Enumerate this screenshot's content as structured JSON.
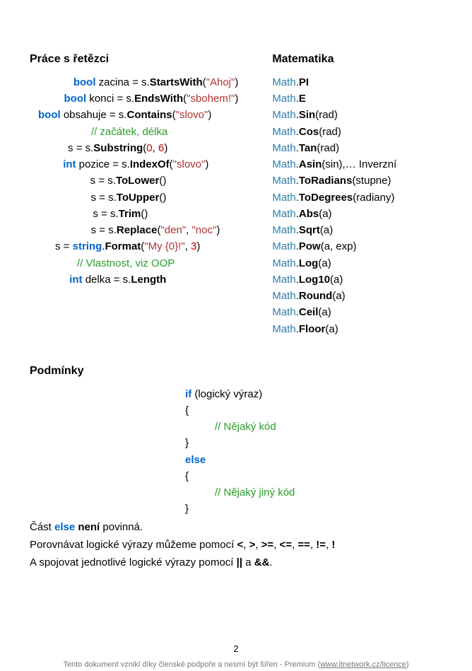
{
  "headings": {
    "strings": "Práce s řetězci",
    "math": "Matematika",
    "cond": "Podmínky"
  },
  "strings_lines": {
    "l1": {
      "kw": "bool",
      "name": " zacina = s.",
      "mtd": "StartsWith",
      "open": "(",
      "arg": "\"Ahoj\"",
      "close": ")"
    },
    "l2": {
      "kw": "bool",
      "name": " konci = s.",
      "mtd": "EndsWith",
      "open": "(",
      "arg": "\"sbohem!\"",
      "close": ")"
    },
    "l3": {
      "kw": "bool",
      "name": " obsahuje = s.",
      "mtd": "Contains",
      "open": "(",
      "arg": "\"slovo\"",
      "close": ")"
    },
    "l4": {
      "cmt": "// začátek, délka"
    },
    "l5": {
      "pre": "s = s.",
      "mtd": "Substring",
      "open": "(",
      "n1": "0",
      "sep": ", ",
      "n2": "6",
      "close": ")"
    },
    "l6": {
      "kw": "int",
      "name": " pozice = s.",
      "mtd": "IndexOf",
      "open": "(",
      "arg": "\"slovo\"",
      "close": ")"
    },
    "l7": {
      "pre": "s = s.",
      "mtd": "ToLower",
      "open": "()",
      "close": ""
    },
    "l8": {
      "pre": "s = s.",
      "mtd": "ToUpper",
      "open": "()",
      "close": ""
    },
    "l9": {
      "pre": "s = s.",
      "mtd": "Trim",
      "open": "()",
      "close": ""
    },
    "l10": {
      "pre": "s =  s.",
      "mtd": "Replace",
      "open": "(",
      "a1": "\"den\"",
      "sep": ", ",
      "a2": "\"noc\"",
      "close": ")"
    },
    "l11": {
      "pre": "s = ",
      "cls": "string",
      "dot": ".",
      "mtd": "Format",
      "open": "(",
      "a1": "\"My {0}!\"",
      "sep": ", ",
      "n1": "3",
      "close": ")"
    },
    "l12": {
      "cmt": "// Vlastnost, viz OOP"
    },
    "l13": {
      "kw": "int",
      "name": " delka = s.",
      "mtd": "Length"
    }
  },
  "math_lines": {
    "m1": {
      "cls": "Math",
      "dot": ".",
      "mtd": "PI",
      "rest": ""
    },
    "m2": {
      "cls": "Math",
      "dot": ".",
      "mtd": "E",
      "rest": ""
    },
    "m3": {
      "cls": "Math",
      "dot": ".",
      "mtd": "Sin",
      "rest": "(rad)"
    },
    "m4": {
      "cls": "Math",
      "dot": ".",
      "mtd": "Cos",
      "rest": "(rad)"
    },
    "m5": {
      "cls": "Math",
      "dot": ".",
      "mtd": "Tan",
      "rest": "(rad)"
    },
    "m6": {
      "cls": "Math",
      "dot": ".",
      "mtd": "Asin",
      "rest": "(sin),… Inverzní"
    },
    "m7": {
      "cls": "Math",
      "dot": ".",
      "mtd": "ToRadians",
      "rest": "(stupne)"
    },
    "m8": {
      "cls": "Math",
      "dot": ".",
      "mtd": "ToDegrees",
      "rest": "(radiany)"
    },
    "m9": {
      "cls": "Math",
      "dot": ".",
      "mtd": "Abs",
      "rest": "(a)"
    },
    "m10": {
      "cls": "Math",
      "dot": ".",
      "mtd": "Sqrt",
      "rest": "(a)"
    },
    "m11": {
      "cls": "Math",
      "dot": ".",
      "mtd": "Pow",
      "rest": "(a, exp)"
    },
    "m12": {
      "cls": "Math",
      "dot": ".",
      "mtd": "Log",
      "rest": "(a)"
    },
    "m13": {
      "cls": "Math",
      "dot": ".",
      "mtd": "Log10",
      "rest": "(a)"
    },
    "m14": {
      "cls": "Math",
      "dot": ".",
      "mtd": "Round",
      "rest": "(a)"
    },
    "m15": {
      "cls": "Math",
      "dot": ".",
      "mtd": "Ceil",
      "rest": "(a)"
    },
    "m16": {
      "cls": "Math",
      "dot": ".",
      "mtd": "Floor",
      "rest": "(a)"
    }
  },
  "cond": {
    "l1": {
      "kw": "if",
      "rest": " (logický výraz)"
    },
    "l2": "{",
    "l3": "// Nějaký kód",
    "l4": "}",
    "l5": {
      "kw": "else"
    },
    "l6": "{",
    "l7": "// Nějaký jiný kód",
    "l8": "}"
  },
  "paras": {
    "p1_pre": "Část ",
    "p1_else": "else",
    "p1_mid": " ",
    "p1_neni": "není",
    "p1_post": " povinná.",
    "p2_pre": "Porovnávat logické výrazy můžeme pomocí ",
    "op_lt": "<",
    "sep": ", ",
    "op_gt": ">",
    "op_ge": ">=",
    "op_le": "<=",
    "op_eq": "==",
    "op_ne": "!=",
    "op_not": "!",
    "p3_pre": "A spojovat jednotlivé logické výrazy pomocí ",
    "op_or": "||",
    "p3_mid": " a ",
    "op_and": "&&",
    "p3_post": "."
  },
  "footer": {
    "page": "2",
    "text_pre": "Tento dokument vznikl díky členské podpoře a nesmí být šířen - Premium (",
    "link": "www.itnetwork.cz/licence",
    "text_post": ")"
  }
}
